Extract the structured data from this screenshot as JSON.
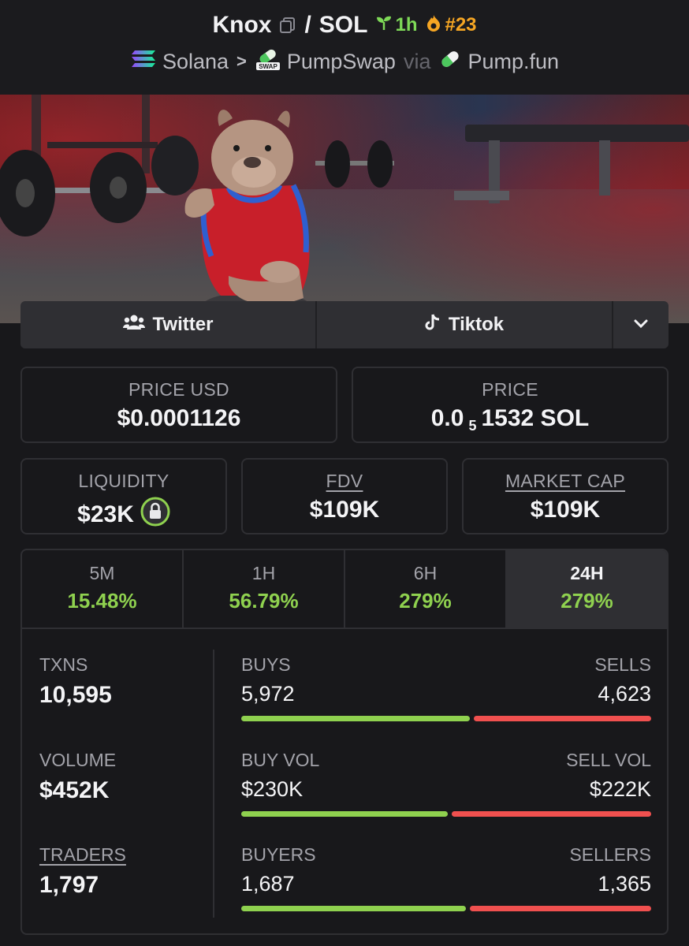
{
  "header": {
    "token_name": "Knox",
    "slash": "/",
    "quote": "SOL",
    "age": "1h",
    "rank": "#23",
    "chain": "Solana",
    "dex": "PumpSwap",
    "via": "via",
    "launchpad": "Pump.fun"
  },
  "links": {
    "twitter": "Twitter",
    "tiktok": "Tiktok"
  },
  "price": {
    "usd_label": "PRICE USD",
    "usd_value": "$0.0001126",
    "native_label": "PRICE",
    "native_lead": "0.0",
    "native_zeros": "5",
    "native_tail": "1532 SOL"
  },
  "metrics": {
    "liquidity_label": "LIQUIDITY",
    "liquidity_value": "$23K",
    "fdv_label": "FDV",
    "fdv_value": "$109K",
    "mcap_label": "MARKET CAP",
    "mcap_value": "$109K"
  },
  "timeframes": [
    {
      "label": "5M",
      "value": "15.48%"
    },
    {
      "label": "1H",
      "value": "56.79%"
    },
    {
      "label": "6H",
      "value": "279%"
    },
    {
      "label": "24H",
      "value": "279%"
    }
  ],
  "selected_timeframe": "24H",
  "stats": {
    "txns_label": "TXNS",
    "txns_value": "10,595",
    "volume_label": "VOLUME",
    "volume_value": "$452K",
    "traders_label": "TRADERS",
    "traders_value": "1,797",
    "buys_label": "BUYS",
    "buys_value": "5,972",
    "sells_label": "SELLS",
    "sells_value": "4,623",
    "buyvol_label": "BUY VOL",
    "buyvol_value": "$230K",
    "sellvol_label": "SELL VOL",
    "sellvol_value": "$222K",
    "buyers_label": "BUYERS",
    "buyers_value": "1,687",
    "sellers_label": "SELLERS",
    "sellers_value": "1,365"
  },
  "ratios": {
    "buys_fraction": 0.564,
    "buyvol_fraction": 0.509,
    "buyers_fraction": 0.553
  },
  "colors": {
    "positive": "#8fd14f",
    "negative": "#f0504f",
    "age": "#7ed957",
    "rank": "#f6a623",
    "background": "#18181b",
    "card_border": "#2f2f33"
  },
  "icons": {
    "copy": "copy-icon",
    "age": "seedling-icon",
    "rank": "flame-icon",
    "chain": "solana-logo",
    "dex": "pumpswap-logo",
    "launchpad": "pill-icon",
    "twitter": "users-icon",
    "tiktok": "tiktok-icon",
    "more": "chevron-down-icon",
    "liquidity": "lock-icon"
  }
}
